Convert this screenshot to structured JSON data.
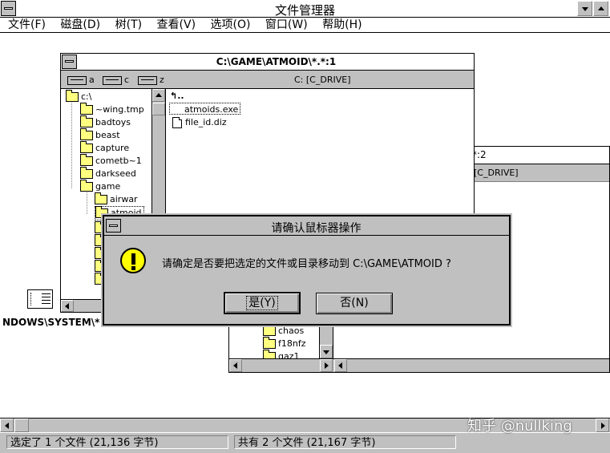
{
  "app": {
    "title": "文件管理器",
    "menu": [
      "文件(F)",
      "磁盘(D)",
      "树(T)",
      "查看(V)",
      "选项(O)",
      "窗口(W)",
      "帮助(H)"
    ]
  },
  "window1": {
    "title": "C:\\GAME\\ATMOID\\*.*:1",
    "drives": [
      {
        "letter": "a"
      },
      {
        "letter": "c"
      },
      {
        "letter": "z"
      }
    ],
    "drive_label": "C: [C_DRIVE]",
    "tree": [
      {
        "name": "c:\\",
        "depth": 0
      },
      {
        "name": "~wing.tmp",
        "depth": 1
      },
      {
        "name": "badtoys",
        "depth": 1
      },
      {
        "name": "beast",
        "depth": 1
      },
      {
        "name": "capture",
        "depth": 1
      },
      {
        "name": "cometb~1",
        "depth": 1
      },
      {
        "name": "darkseed",
        "depth": 1
      },
      {
        "name": "game",
        "depth": 1
      },
      {
        "name": "airwar",
        "depth": 2
      },
      {
        "name": "atmoid",
        "depth": 2
      }
    ],
    "files": [
      {
        "name": "atmoids.exe",
        "type": "exe"
      },
      {
        "name": "file_id.diz",
        "type": "doc"
      }
    ]
  },
  "window2": {
    "title_fragment": "*:2",
    "drive_label": "[C_DRIVE]",
    "tree": [
      "chaos",
      "f18nfz",
      "gaz1"
    ]
  },
  "minimized_icon": {
    "label": "NDOWS\\SYSTEM\\*"
  },
  "dialog": {
    "title": "请确认鼠标器操作",
    "message": "请确定是否要把选定的文件或目录移动到 C:\\GAME\\ATMOID ?",
    "yes": "是(Y)",
    "no": "否(N)"
  },
  "status": {
    "selected": "选定了 1 个文件 (21,136 字节)",
    "total": "共有 2 个文件 (21,167 字节)"
  },
  "watermark": "知乎 @nullking",
  "colors": {
    "face": "#c0c0c0",
    "shadow": "#808080",
    "warning": "#ffff00",
    "folder": "#ffff80"
  }
}
